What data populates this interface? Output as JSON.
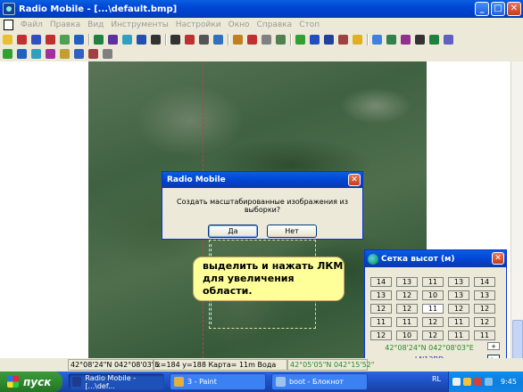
{
  "window": {
    "title": "Radio Mobile - [...\\default.bmp]",
    "minimize": "_",
    "maximize": "□",
    "close": "✕"
  },
  "menu": [
    "Файл",
    "Правка",
    "Вид",
    "Инструменты",
    "Настройки",
    "Окно",
    "Справка",
    "Стоп"
  ],
  "toolbar1": [
    "#e8c030",
    "#c03030",
    "#3050c0",
    "#c03030",
    "#50a050",
    "#2060c0",
    "#208040",
    "#6030a0",
    "#30a0c0",
    "#2050b0",
    "#333",
    "#333",
    "#c03030",
    "#555",
    "#3070c0",
    "#c08020",
    "#c03030",
    "#808080",
    "#508050",
    "#30a030",
    "#2050c0",
    "#2040a0",
    "#a04040",
    "#e0b020",
    "#4080e0",
    "#308050",
    "#903090",
    "#333",
    "#208040",
    "#6060c0"
  ],
  "toolbar2": [
    "#30a030",
    "#2060c0",
    "#30a0c0",
    "#a030a0",
    "#c0a030",
    "#3060c0",
    "#a04040",
    "#808080"
  ],
  "statusbar": {
    "coords": "42°08'24\"N  042°08'03\"E",
    "xy": "x=184 y=188 Карта= 11m Вода",
    "coords2": "42°05'05\"N 042°15'52\""
  },
  "dialog": {
    "title": "Radio Mobile",
    "close": "✕",
    "message": "Создать масштабированные изображения из выборки?",
    "yes": "Да",
    "no": "Нет"
  },
  "note": {
    "line1": "выделить и нажать ЛКМ",
    "line2": "для увеличения области."
  },
  "heights_panel": {
    "title": "Сетка высот (м)",
    "close": "✕",
    "grid": [
      [
        "14",
        "13",
        "11",
        "13",
        "14"
      ],
      [
        "13",
        "12",
        "10",
        "13",
        "13"
      ],
      [
        "12",
        "12",
        "11",
        "12",
        "12"
      ],
      [
        "11",
        "11",
        "12",
        "11",
        "12"
      ],
      [
        "12",
        "10",
        "12",
        "11",
        "11"
      ]
    ],
    "coords": "42°08'24\"N  042°08'03\"E",
    "locator": "LN12BD",
    "plus": "+",
    "next": ">"
  },
  "taskbar": {
    "start": "пуск",
    "tasks": [
      "Radio Mobile - [...\\def...",
      "3 - Paint",
      "boot - Блокнот"
    ],
    "lang": "RL",
    "time": "9:45"
  },
  "colors": {
    "accent": "#0a5ee0",
    "note_bg": "#ffff99",
    "taskbar": "#245edb",
    "start": "#2f8a2f"
  }
}
